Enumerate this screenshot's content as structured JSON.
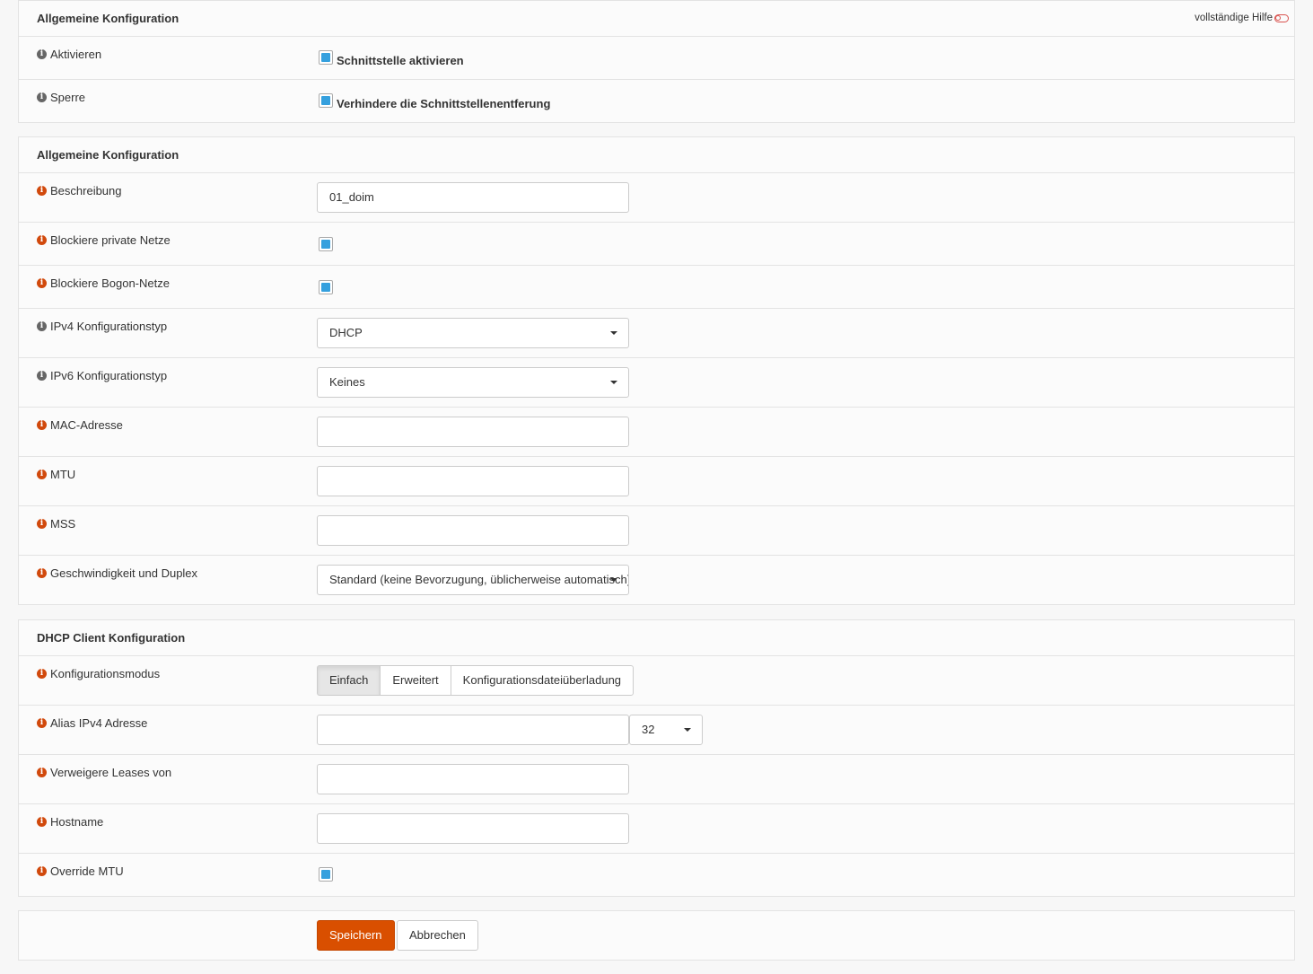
{
  "section1": {
    "title": "Allgemeine Konfiguration",
    "help_link": "vollständige Hilfe",
    "rows": [
      {
        "label": "Aktivieren",
        "checkbox_label": "Schnittstelle aktivieren",
        "checked": true
      },
      {
        "label": "Sperre",
        "checkbox_label": "Verhindere die Schnittstellenentferung",
        "checked": true
      }
    ]
  },
  "section2": {
    "title": "Allgemeine Konfiguration",
    "description": {
      "label": "Beschreibung",
      "value": "01_doim"
    },
    "block_private": {
      "label": "Blockiere private Netze",
      "checked": true
    },
    "block_bogon": {
      "label": "Blockiere Bogon-Netze",
      "checked": true
    },
    "ipv4_type": {
      "label": "IPv4 Konfigurationstyp",
      "value": "DHCP"
    },
    "ipv6_type": {
      "label": "IPv6 Konfigurationstyp",
      "value": "Keines"
    },
    "mac": {
      "label": "MAC-Adresse",
      "value": ""
    },
    "mtu": {
      "label": "MTU",
      "value": ""
    },
    "mss": {
      "label": "MSS",
      "value": ""
    },
    "speed": {
      "label": "Geschwindigkeit und Duplex",
      "value": "Standard (keine Bevorzugung, üblicherweise automatisch)"
    }
  },
  "section3": {
    "title": "DHCP Client Konfiguration",
    "mode": {
      "label": "Konfigurationsmodus",
      "options": [
        "Einfach",
        "Erweitert",
        "Konfigurationsdateiüberladung"
      ],
      "active": "Einfach"
    },
    "alias": {
      "label": "Alias IPv4 Adresse",
      "value": "",
      "prefix": "32"
    },
    "reject_leases": {
      "label": "Verweigere Leases von",
      "value": ""
    },
    "hostname": {
      "label": "Hostname",
      "value": ""
    },
    "override_mtu": {
      "label": "Override MTU",
      "checked": true
    }
  },
  "actions": {
    "save": "Speichern",
    "cancel": "Abbrechen"
  },
  "colors": {
    "accent": "#d94f00",
    "checkbox": "#35a0de",
    "info_orange": "#d1490c"
  }
}
